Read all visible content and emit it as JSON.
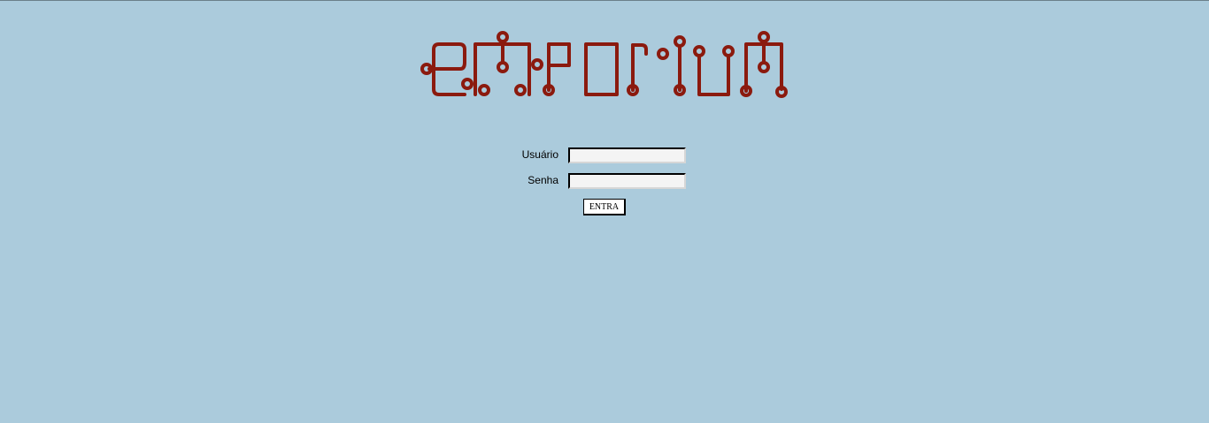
{
  "logo": {
    "text": "emporium",
    "color": "#8b1a0e"
  },
  "form": {
    "username_label": "Usuário",
    "username_value": "",
    "password_label": "Senha",
    "password_value": "",
    "submit_label": "ENTRA"
  },
  "colors": {
    "background": "#abcbdc",
    "logo": "#8b1a0e"
  }
}
